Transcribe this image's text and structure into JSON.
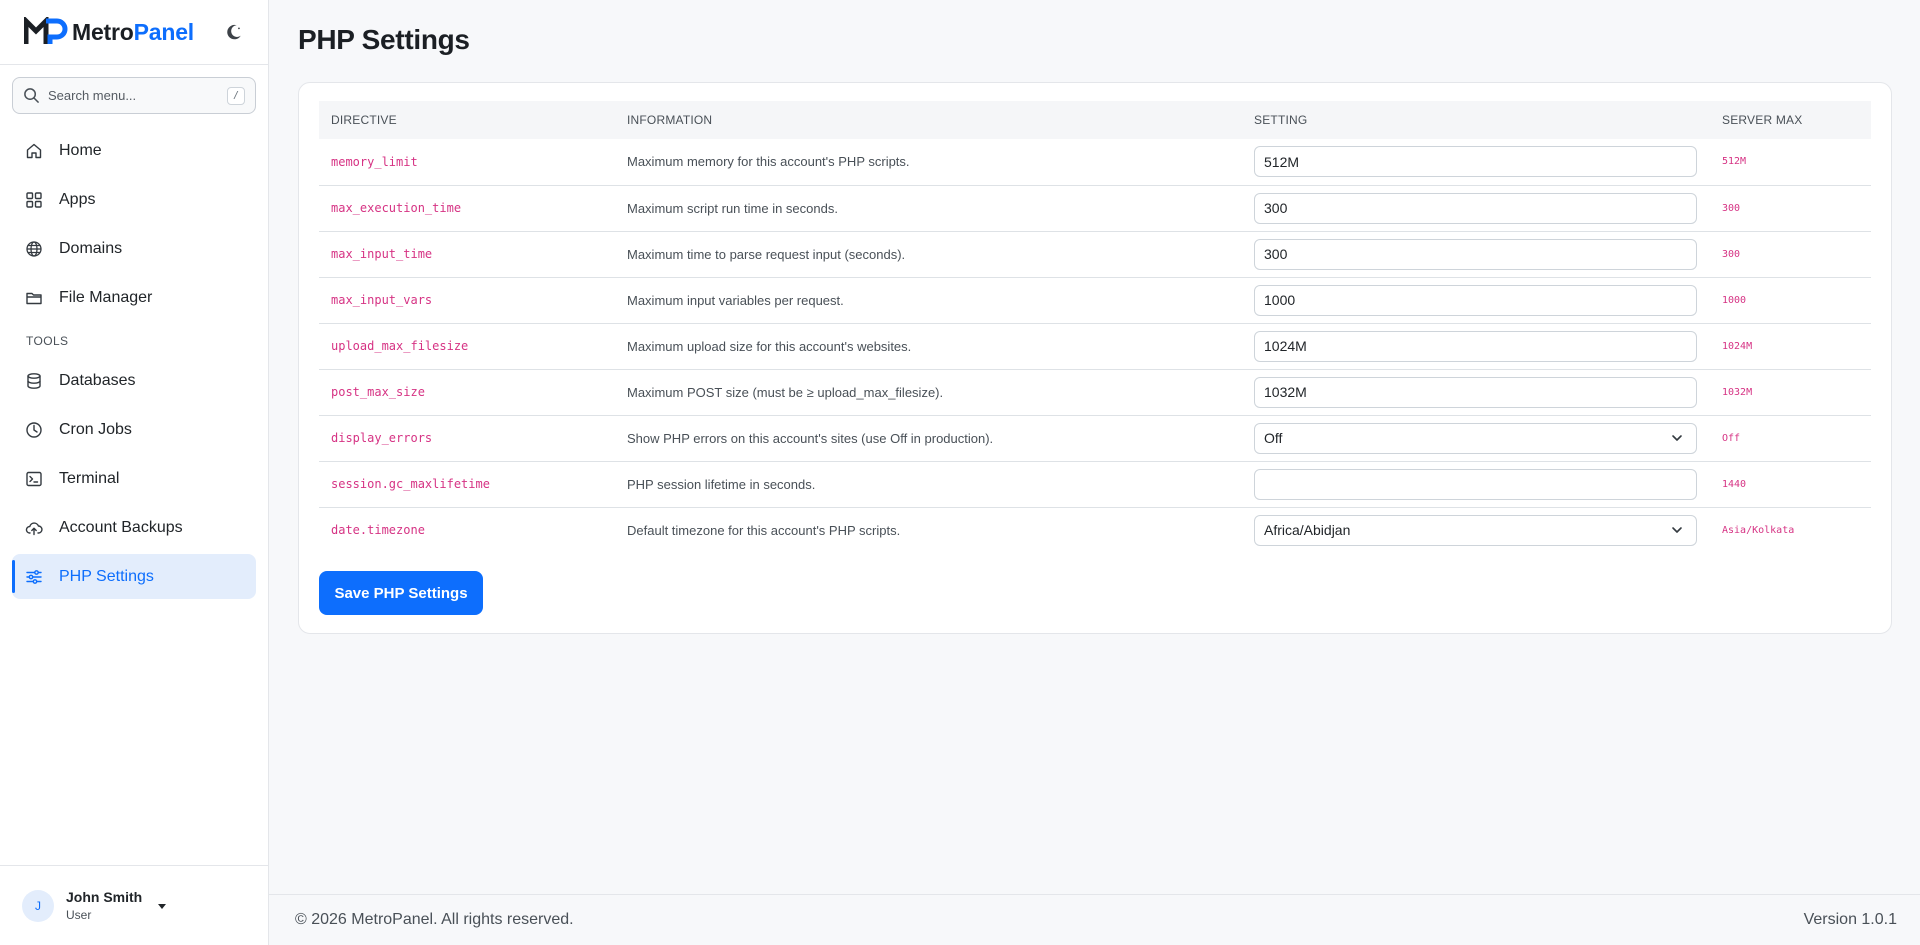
{
  "brand": {
    "name_part1": "Metro",
    "name_part2": "Panel",
    "logo_icon": "metropanel-logo-icon",
    "theme_icon": "moon-icon"
  },
  "search": {
    "placeholder": "Search menu...",
    "shortcut": "/"
  },
  "sidebar": {
    "items": [
      {
        "label": "Home",
        "icon": "home-icon"
      },
      {
        "label": "Apps",
        "icon": "grid-icon"
      },
      {
        "label": "Domains",
        "icon": "globe-icon"
      },
      {
        "label": "File Manager",
        "icon": "folder-icon"
      }
    ],
    "tools_title": "TOOLS",
    "tools": [
      {
        "label": "Databases",
        "icon": "database-icon"
      },
      {
        "label": "Cron Jobs",
        "icon": "clock-icon"
      },
      {
        "label": "Terminal",
        "icon": "terminal-icon"
      },
      {
        "label": "Account Backups",
        "icon": "cloud-upload-icon"
      },
      {
        "label": "PHP Settings",
        "icon": "sliders-icon",
        "active": true
      }
    ]
  },
  "user": {
    "initial": "J",
    "name": "John Smith",
    "role": "User"
  },
  "page": {
    "title": "PHP Settings"
  },
  "table": {
    "headers": [
      "DIRECTIVE",
      "INFORMATION",
      "SETTING",
      "SERVER MAX"
    ],
    "rows": [
      {
        "directive": "memory_limit",
        "info": "Maximum memory for this account's PHP scripts.",
        "setting": "512M",
        "type": "input",
        "max": "512M"
      },
      {
        "directive": "max_execution_time",
        "info": "Maximum script run time in seconds.",
        "setting": "300",
        "type": "input",
        "max": "300"
      },
      {
        "directive": "max_input_time",
        "info": "Maximum time to parse request input (seconds).",
        "setting": "300",
        "type": "input",
        "max": "300"
      },
      {
        "directive": "max_input_vars",
        "info": "Maximum input variables per request.",
        "setting": "1000",
        "type": "input",
        "max": "1000"
      },
      {
        "directive": "upload_max_filesize",
        "info": "Maximum upload size for this account's websites.",
        "setting": "1024M",
        "type": "input",
        "max": "1024M"
      },
      {
        "directive": "post_max_size",
        "info": "Maximum POST size (must be ≥ upload_max_filesize).",
        "setting": "1032M",
        "type": "input",
        "max": "1032M"
      },
      {
        "directive": "display_errors",
        "info": "Show PHP errors on this account's sites (use Off in production).",
        "setting": "Off",
        "type": "select",
        "max": "Off"
      },
      {
        "directive": "session.gc_maxlifetime",
        "info": "PHP session lifetime in seconds.",
        "setting": "",
        "type": "input",
        "max": "1440"
      },
      {
        "directive": "date.timezone",
        "info": "Default timezone for this account's PHP scripts.",
        "setting": "Africa/Abidjan",
        "type": "select",
        "max": "Asia/Kolkata"
      }
    ]
  },
  "actions": {
    "save_label": "Save PHP Settings"
  },
  "footer": {
    "copyright": "© 2026 MetroPanel. All rights reserved.",
    "version": "Version 1.0.1"
  },
  "colors": {
    "accent": "#0d6efd",
    "directive_pink": "#d63384",
    "active_bg": "#e3edfc"
  }
}
